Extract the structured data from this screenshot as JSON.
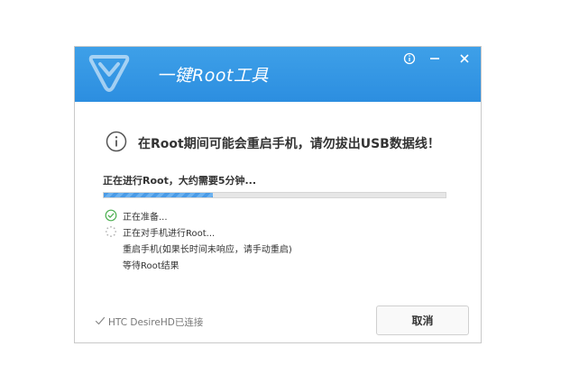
{
  "window": {
    "title": "一键Root工具",
    "accent_color": "#2c8ee0",
    "controls": {
      "info_icon": "info-icon",
      "minimize_icon": "minimize-icon",
      "close_icon": "close-icon"
    }
  },
  "warning": {
    "icon": "info-circle-icon",
    "text": "在Root期间可能会重启手机，请勿拔出USB数据线！"
  },
  "progress": {
    "label": "正在进行Root，大约需要5分钟...",
    "percent": 32
  },
  "steps": [
    {
      "label": "正在准备...",
      "state": "done",
      "icon": "check-circle-icon"
    },
    {
      "label": "正在对手机进行Root...",
      "state": "in-progress",
      "icon": "loading-spinner-icon"
    },
    {
      "label": "重启手机(如果长时间未响应，请手动重启)",
      "state": "pending"
    },
    {
      "label": "等待Root结果",
      "state": "pending"
    }
  ],
  "status": {
    "icon": "checkmark-icon",
    "text": "HTC DesireHD已连接"
  },
  "cancel_button": {
    "label": "取消"
  }
}
